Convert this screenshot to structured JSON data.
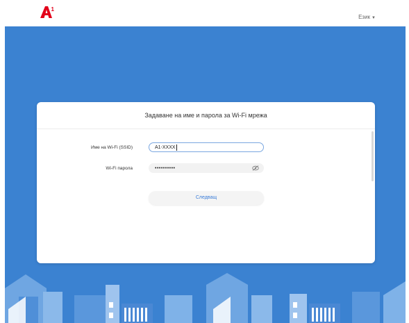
{
  "header": {
    "brand_logo": "A1",
    "language_label": "Език",
    "language_caret_icon": "caret-down-icon"
  },
  "dialog": {
    "title": "Задаване на име и парола за Wi-Fi мрежа",
    "ssid_label": "Име на Wi-Fi (SSID)",
    "ssid_value": "A1-XXXX",
    "password_label": "Wi-Fi парола",
    "password_value": "••••••••••",
    "password_toggle_icon": "eye-off-icon",
    "next_button": "Следващ"
  },
  "colors": {
    "hero_background": "#3b82d1",
    "brand_red": "#e2001a",
    "accent_blue": "#3b7dd8"
  }
}
